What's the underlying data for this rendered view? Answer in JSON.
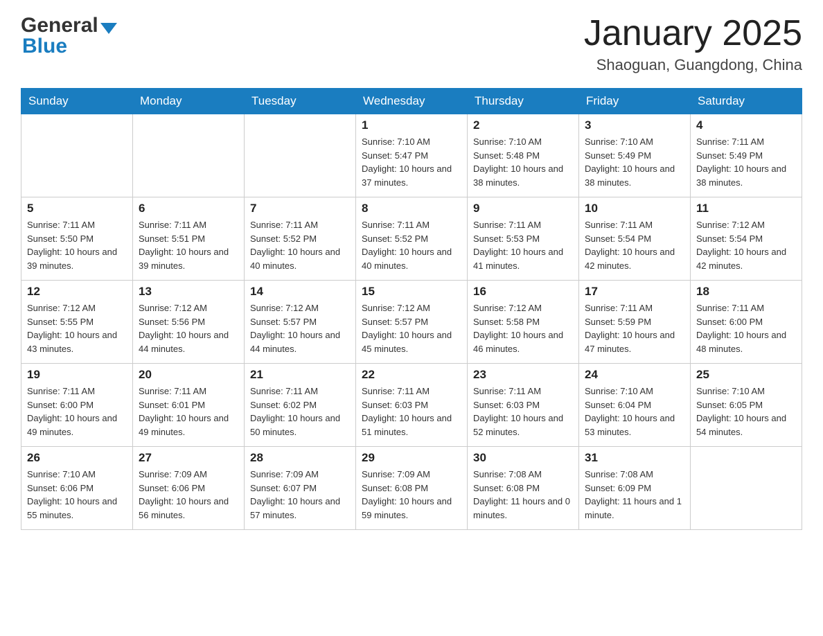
{
  "header": {
    "logo_general": "General",
    "logo_blue": "Blue",
    "month_title": "January 2025",
    "location": "Shaoguan, Guangdong, China"
  },
  "calendar": {
    "days_of_week": [
      "Sunday",
      "Monday",
      "Tuesday",
      "Wednesday",
      "Thursday",
      "Friday",
      "Saturday"
    ],
    "weeks": [
      [
        {
          "day": "",
          "sunrise": "",
          "sunset": "",
          "daylight": ""
        },
        {
          "day": "",
          "sunrise": "",
          "sunset": "",
          "daylight": ""
        },
        {
          "day": "",
          "sunrise": "",
          "sunset": "",
          "daylight": ""
        },
        {
          "day": "1",
          "sunrise": "Sunrise: 7:10 AM",
          "sunset": "Sunset: 5:47 PM",
          "daylight": "Daylight: 10 hours and 37 minutes."
        },
        {
          "day": "2",
          "sunrise": "Sunrise: 7:10 AM",
          "sunset": "Sunset: 5:48 PM",
          "daylight": "Daylight: 10 hours and 38 minutes."
        },
        {
          "day": "3",
          "sunrise": "Sunrise: 7:10 AM",
          "sunset": "Sunset: 5:49 PM",
          "daylight": "Daylight: 10 hours and 38 minutes."
        },
        {
          "day": "4",
          "sunrise": "Sunrise: 7:11 AM",
          "sunset": "Sunset: 5:49 PM",
          "daylight": "Daylight: 10 hours and 38 minutes."
        }
      ],
      [
        {
          "day": "5",
          "sunrise": "Sunrise: 7:11 AM",
          "sunset": "Sunset: 5:50 PM",
          "daylight": "Daylight: 10 hours and 39 minutes."
        },
        {
          "day": "6",
          "sunrise": "Sunrise: 7:11 AM",
          "sunset": "Sunset: 5:51 PM",
          "daylight": "Daylight: 10 hours and 39 minutes."
        },
        {
          "day": "7",
          "sunrise": "Sunrise: 7:11 AM",
          "sunset": "Sunset: 5:52 PM",
          "daylight": "Daylight: 10 hours and 40 minutes."
        },
        {
          "day": "8",
          "sunrise": "Sunrise: 7:11 AM",
          "sunset": "Sunset: 5:52 PM",
          "daylight": "Daylight: 10 hours and 40 minutes."
        },
        {
          "day": "9",
          "sunrise": "Sunrise: 7:11 AM",
          "sunset": "Sunset: 5:53 PM",
          "daylight": "Daylight: 10 hours and 41 minutes."
        },
        {
          "day": "10",
          "sunrise": "Sunrise: 7:11 AM",
          "sunset": "Sunset: 5:54 PM",
          "daylight": "Daylight: 10 hours and 42 minutes."
        },
        {
          "day": "11",
          "sunrise": "Sunrise: 7:12 AM",
          "sunset": "Sunset: 5:54 PM",
          "daylight": "Daylight: 10 hours and 42 minutes."
        }
      ],
      [
        {
          "day": "12",
          "sunrise": "Sunrise: 7:12 AM",
          "sunset": "Sunset: 5:55 PM",
          "daylight": "Daylight: 10 hours and 43 minutes."
        },
        {
          "day": "13",
          "sunrise": "Sunrise: 7:12 AM",
          "sunset": "Sunset: 5:56 PM",
          "daylight": "Daylight: 10 hours and 44 minutes."
        },
        {
          "day": "14",
          "sunrise": "Sunrise: 7:12 AM",
          "sunset": "Sunset: 5:57 PM",
          "daylight": "Daylight: 10 hours and 44 minutes."
        },
        {
          "day": "15",
          "sunrise": "Sunrise: 7:12 AM",
          "sunset": "Sunset: 5:57 PM",
          "daylight": "Daylight: 10 hours and 45 minutes."
        },
        {
          "day": "16",
          "sunrise": "Sunrise: 7:12 AM",
          "sunset": "Sunset: 5:58 PM",
          "daylight": "Daylight: 10 hours and 46 minutes."
        },
        {
          "day": "17",
          "sunrise": "Sunrise: 7:11 AM",
          "sunset": "Sunset: 5:59 PM",
          "daylight": "Daylight: 10 hours and 47 minutes."
        },
        {
          "day": "18",
          "sunrise": "Sunrise: 7:11 AM",
          "sunset": "Sunset: 6:00 PM",
          "daylight": "Daylight: 10 hours and 48 minutes."
        }
      ],
      [
        {
          "day": "19",
          "sunrise": "Sunrise: 7:11 AM",
          "sunset": "Sunset: 6:00 PM",
          "daylight": "Daylight: 10 hours and 49 minutes."
        },
        {
          "day": "20",
          "sunrise": "Sunrise: 7:11 AM",
          "sunset": "Sunset: 6:01 PM",
          "daylight": "Daylight: 10 hours and 49 minutes."
        },
        {
          "day": "21",
          "sunrise": "Sunrise: 7:11 AM",
          "sunset": "Sunset: 6:02 PM",
          "daylight": "Daylight: 10 hours and 50 minutes."
        },
        {
          "day": "22",
          "sunrise": "Sunrise: 7:11 AM",
          "sunset": "Sunset: 6:03 PM",
          "daylight": "Daylight: 10 hours and 51 minutes."
        },
        {
          "day": "23",
          "sunrise": "Sunrise: 7:11 AM",
          "sunset": "Sunset: 6:03 PM",
          "daylight": "Daylight: 10 hours and 52 minutes."
        },
        {
          "day": "24",
          "sunrise": "Sunrise: 7:10 AM",
          "sunset": "Sunset: 6:04 PM",
          "daylight": "Daylight: 10 hours and 53 minutes."
        },
        {
          "day": "25",
          "sunrise": "Sunrise: 7:10 AM",
          "sunset": "Sunset: 6:05 PM",
          "daylight": "Daylight: 10 hours and 54 minutes."
        }
      ],
      [
        {
          "day": "26",
          "sunrise": "Sunrise: 7:10 AM",
          "sunset": "Sunset: 6:06 PM",
          "daylight": "Daylight: 10 hours and 55 minutes."
        },
        {
          "day": "27",
          "sunrise": "Sunrise: 7:09 AM",
          "sunset": "Sunset: 6:06 PM",
          "daylight": "Daylight: 10 hours and 56 minutes."
        },
        {
          "day": "28",
          "sunrise": "Sunrise: 7:09 AM",
          "sunset": "Sunset: 6:07 PM",
          "daylight": "Daylight: 10 hours and 57 minutes."
        },
        {
          "day": "29",
          "sunrise": "Sunrise: 7:09 AM",
          "sunset": "Sunset: 6:08 PM",
          "daylight": "Daylight: 10 hours and 59 minutes."
        },
        {
          "day": "30",
          "sunrise": "Sunrise: 7:08 AM",
          "sunset": "Sunset: 6:08 PM",
          "daylight": "Daylight: 11 hours and 0 minutes."
        },
        {
          "day": "31",
          "sunrise": "Sunrise: 7:08 AM",
          "sunset": "Sunset: 6:09 PM",
          "daylight": "Daylight: 11 hours and 1 minute."
        },
        {
          "day": "",
          "sunrise": "",
          "sunset": "",
          "daylight": ""
        }
      ]
    ]
  }
}
